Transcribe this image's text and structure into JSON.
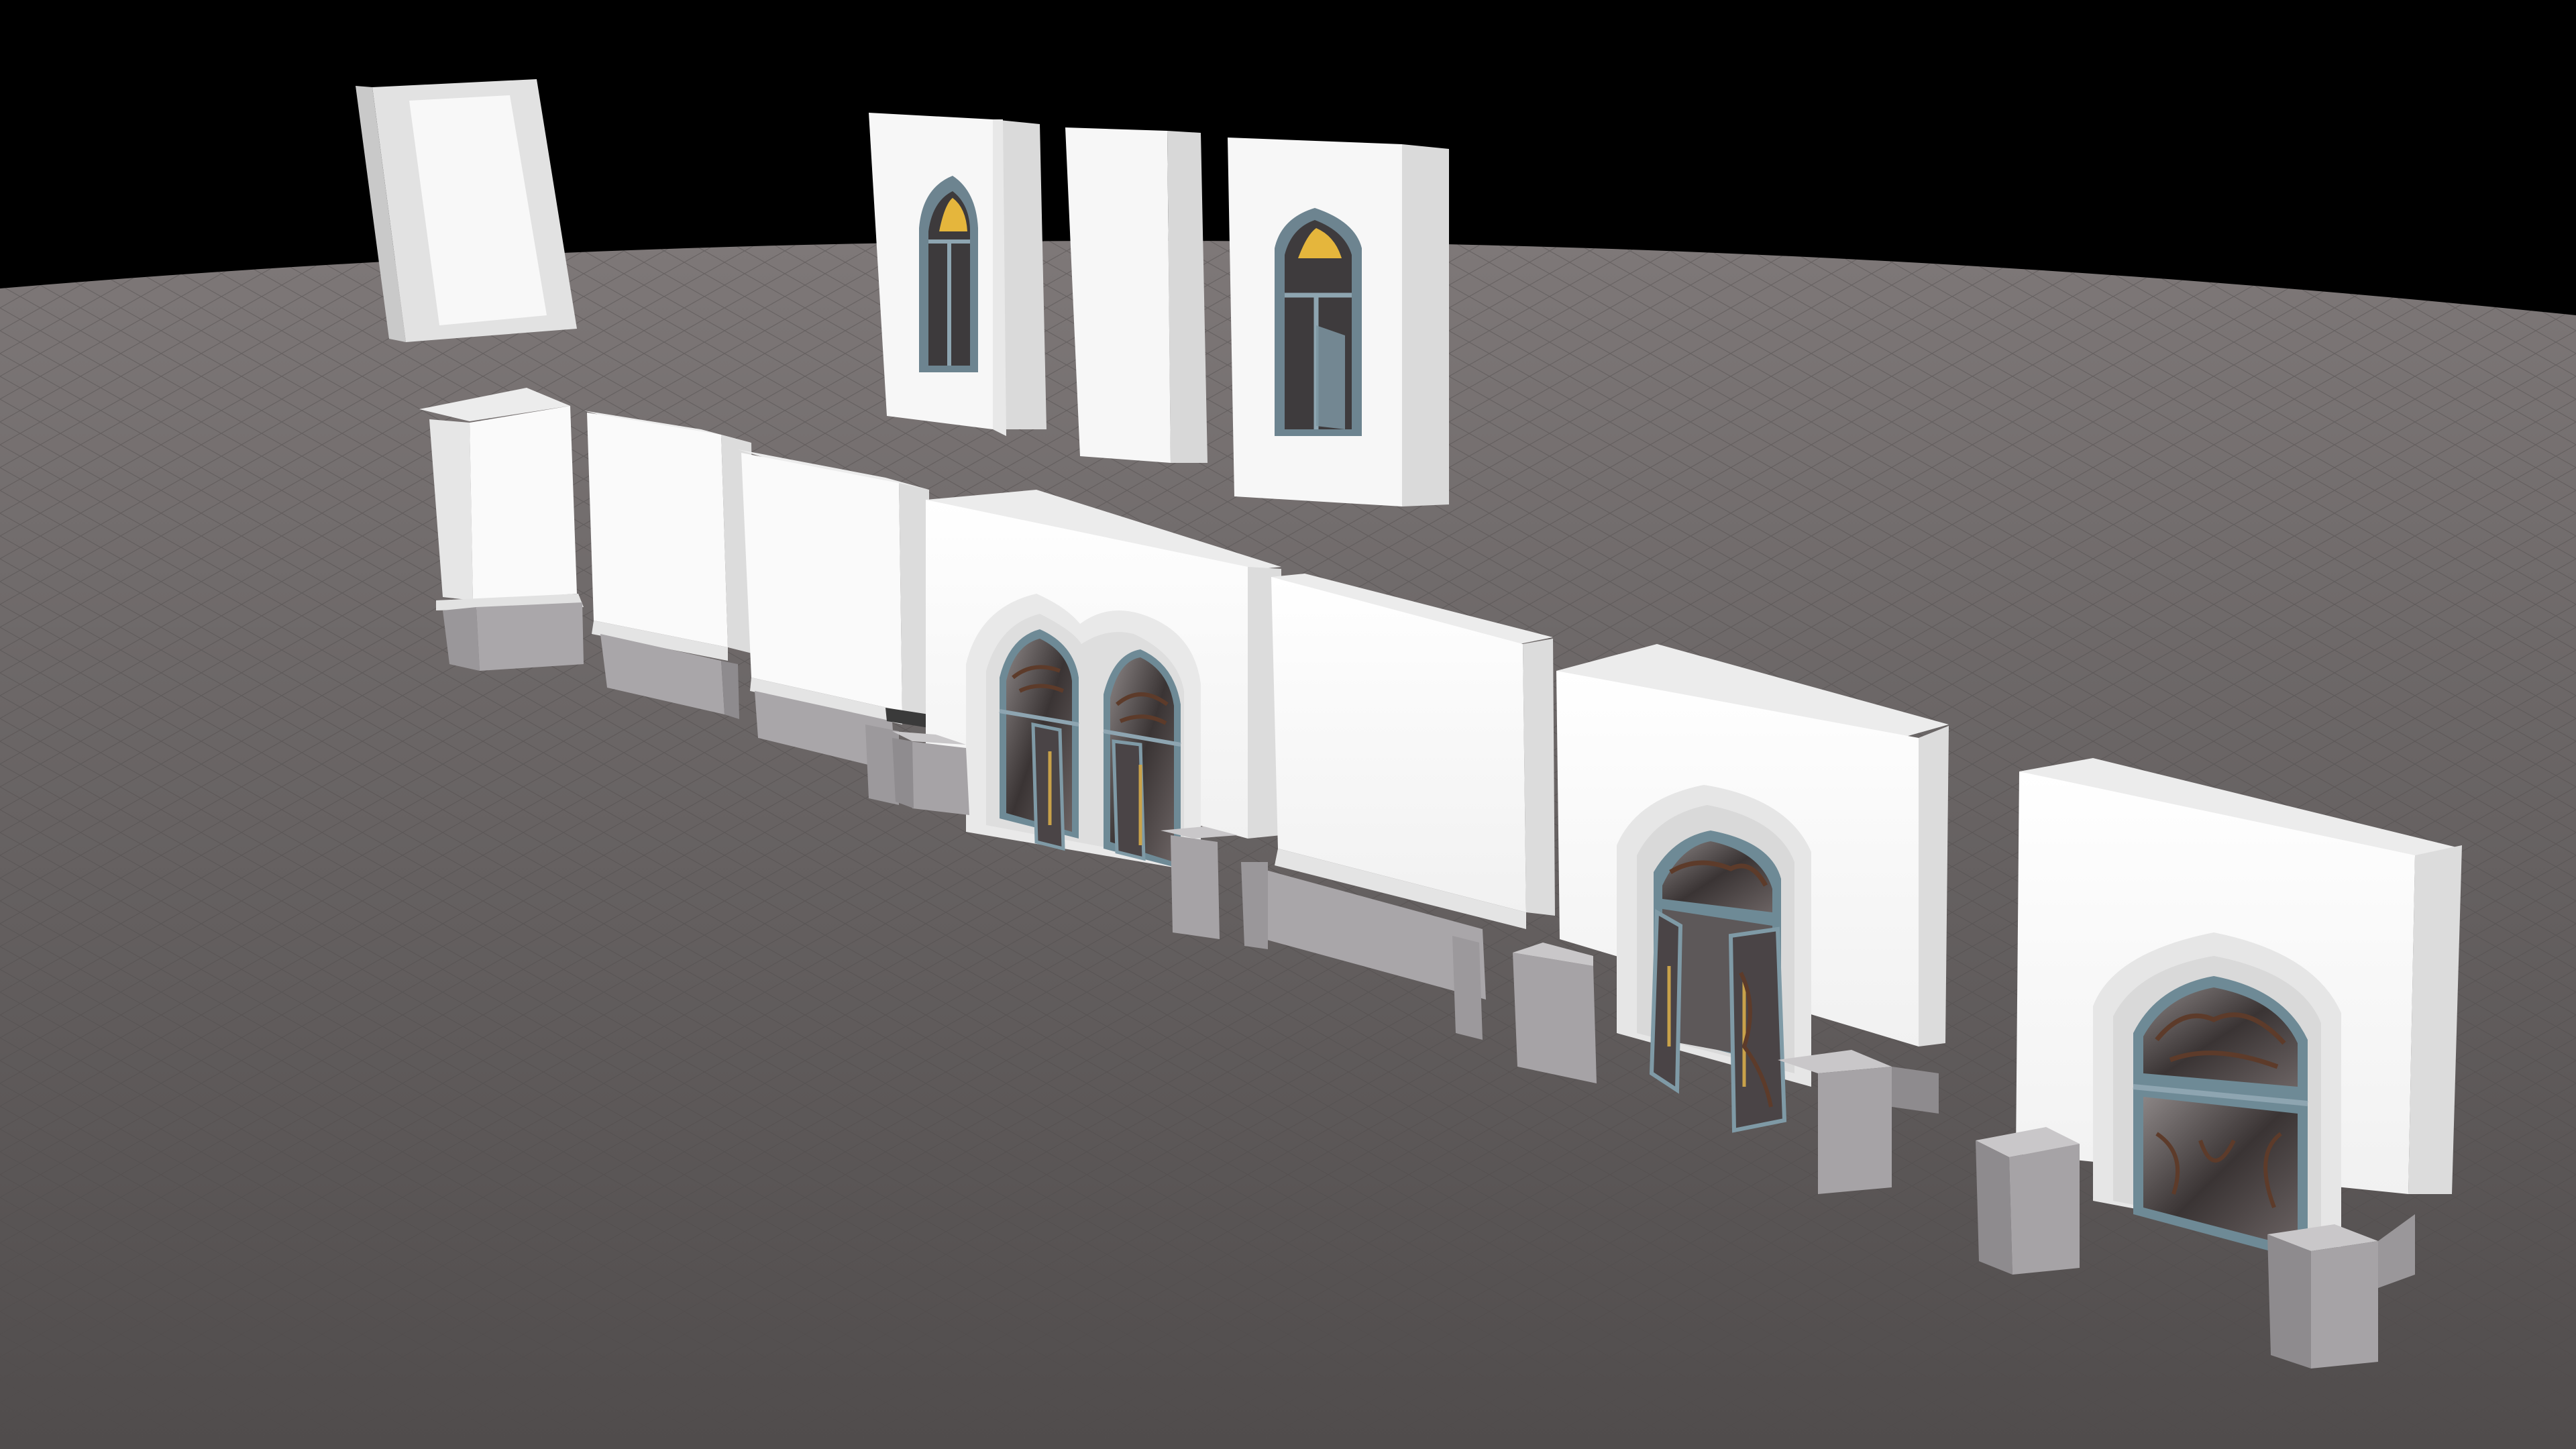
{
  "scene": {
    "colors": {
      "sky": "#000000",
      "floor": "#5e5a59",
      "floor_far": "#7e7878",
      "wall_front": "#f6f6f6",
      "wall_side": "#dcdcdc",
      "wall_top": "#ececec",
      "plinth_front": "#a5a2a5",
      "plinth_side": "#8e8b8e",
      "plinth_top": "#c8c6c8",
      "frame": "#7f9aa6",
      "glass": "#3a3434",
      "glass_light": "#8b8585",
      "ornament": "#5d3b2a",
      "brass": "#c9a24a",
      "window_glow": "#e5b63c"
    },
    "icons": {
      "window": "arched-window-icon",
      "door": "arched-double-door-icon"
    }
  }
}
